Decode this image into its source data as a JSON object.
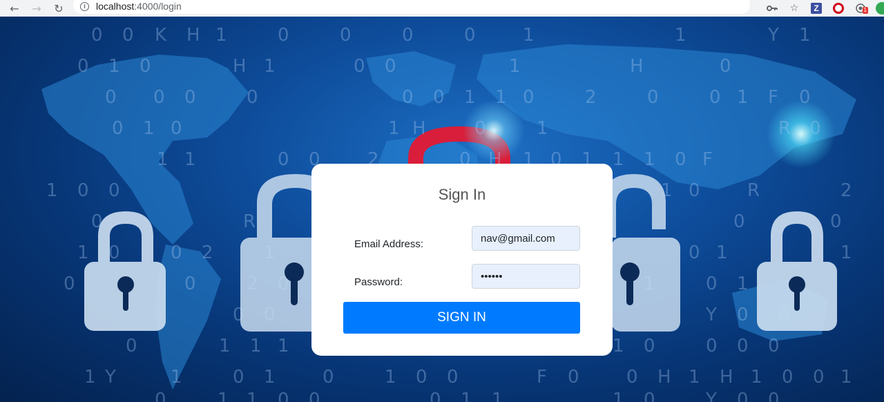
{
  "browser": {
    "url_host": "localhost",
    "url_path": ":4000/login",
    "extension_badge": "1"
  },
  "login": {
    "title": "Sign In",
    "email_label": "Email Address:",
    "email_value": "nav@gmail.com",
    "password_label": "Password:",
    "password_value": "••••••",
    "submit_label": "SIGN IN"
  },
  "background": {
    "digits": [
      [
        "0",
        140,
        52
      ],
      [
        "0",
        185,
        52
      ],
      [
        "K",
        232,
        52
      ],
      [
        "H",
        278,
        52
      ],
      [
        "1",
        320,
        52
      ],
      [
        "0",
        410,
        52
      ],
      [
        "0",
        500,
        52
      ],
      [
        "0",
        590,
        52
      ],
      [
        "0",
        680,
        52
      ],
      [
        "1",
        765,
        52
      ],
      [
        "1",
        985,
        52
      ],
      [
        "Y",
        1120,
        52
      ],
      [
        "1",
        1165,
        52
      ],
      [
        "0",
        120,
        97
      ],
      [
        "1",
        165,
        97
      ],
      [
        "0",
        210,
        97
      ],
      [
        "H",
        345,
        97
      ],
      [
        "1",
        390,
        97
      ],
      [
        "0",
        520,
        97
      ],
      [
        "0",
        565,
        97
      ],
      [
        "1",
        745,
        97
      ],
      [
        "H",
        920,
        97
      ],
      [
        "0",
        1050,
        97
      ],
      [
        "0",
        160,
        142
      ],
      [
        "0",
        230,
        142
      ],
      [
        "0",
        275,
        142
      ],
      [
        "0",
        365,
        142
      ],
      [
        "0",
        590,
        142
      ],
      [
        "0",
        635,
        142
      ],
      [
        "1",
        680,
        142
      ],
      [
        "1",
        725,
        142
      ],
      [
        "0",
        765,
        142
      ],
      [
        "2",
        855,
        142
      ],
      [
        "0",
        945,
        142
      ],
      [
        "0",
        1035,
        142
      ],
      [
        "1",
        1075,
        142
      ],
      [
        "F",
        1120,
        142
      ],
      [
        "0",
        1165,
        142
      ],
      [
        "0",
        170,
        187
      ],
      [
        "1",
        215,
        187
      ],
      [
        "0",
        255,
        187
      ],
      [
        "1",
        570,
        187
      ],
      [
        "H",
        605,
        187
      ],
      [
        "0",
        695,
        187
      ],
      [
        "1",
        785,
        187
      ],
      [
        "R",
        1135,
        187
      ],
      [
        "0",
        1180,
        187
      ],
      [
        "1",
        235,
        232
      ],
      [
        "1",
        275,
        232
      ],
      [
        "0",
        410,
        232
      ],
      [
        "0",
        455,
        232
      ],
      [
        "2",
        540,
        232
      ],
      [
        "0",
        673,
        232
      ],
      [
        "H",
        715,
        232
      ],
      [
        "1",
        765,
        232
      ],
      [
        "0",
        805,
        232
      ],
      [
        "1",
        850,
        232
      ],
      [
        "1",
        895,
        232
      ],
      [
        "1",
        940,
        232
      ],
      [
        "0",
        985,
        232
      ],
      [
        "F",
        1025,
        232
      ],
      [
        "1",
        75,
        277
      ],
      [
        "0",
        120,
        277
      ],
      [
        "0",
        165,
        277
      ],
      [
        "1",
        965,
        277
      ],
      [
        "0",
        1005,
        277
      ],
      [
        "R",
        1090,
        277
      ],
      [
        "2",
        1225,
        277
      ],
      [
        "0",
        140,
        322
      ],
      [
        "R",
        360,
        322
      ],
      [
        "0",
        1070,
        322
      ],
      [
        "0",
        1210,
        322
      ],
      [
        "1",
        120,
        367
      ],
      [
        "0",
        165,
        367
      ],
      [
        "0",
        255,
        367
      ],
      [
        "2",
        300,
        367
      ],
      [
        "1",
        390,
        367
      ],
      [
        "0",
        1005,
        367
      ],
      [
        "1",
        1045,
        367
      ],
      [
        "1",
        1225,
        367
      ],
      [
        "0",
        100,
        412
      ],
      [
        "0",
        275,
        412
      ],
      [
        "2",
        365,
        412
      ],
      [
        "0",
        410,
        412
      ],
      [
        "1",
        940,
        412
      ],
      [
        "0",
        1030,
        412
      ],
      [
        "1",
        1075,
        412
      ],
      [
        "0",
        345,
        457
      ],
      [
        "0",
        390,
        457
      ],
      [
        "Y",
        1030,
        457
      ],
      [
        "0",
        1075,
        457
      ],
      [
        "0",
        1135,
        457
      ],
      [
        "0",
        190,
        502
      ],
      [
        "1",
        325,
        502
      ],
      [
        "1",
        370,
        502
      ],
      [
        "1",
        410,
        502
      ],
      [
        "1",
        895,
        502
      ],
      [
        "0",
        940,
        502
      ],
      [
        "0",
        1030,
        502
      ],
      [
        "0",
        1075,
        502
      ],
      [
        "0",
        1120,
        502
      ],
      [
        "1",
        130,
        547
      ],
      [
        "Y",
        160,
        547
      ],
      [
        "1",
        255,
        547
      ],
      [
        "0",
        345,
        547
      ],
      [
        "1",
        390,
        547
      ],
      [
        "0",
        475,
        547
      ],
      [
        "1",
        565,
        547
      ],
      [
        "0",
        610,
        547
      ],
      [
        "0",
        655,
        547
      ],
      [
        "F",
        785,
        547
      ],
      [
        "0",
        830,
        547
      ],
      [
        "0",
        915,
        547
      ],
      [
        "H",
        960,
        547
      ],
      [
        "1",
        1005,
        547
      ],
      [
        "H",
        1050,
        547
      ],
      [
        "1",
        1095,
        547
      ],
      [
        "0",
        1140,
        547
      ],
      [
        "0",
        1185,
        547
      ],
      [
        "1",
        1225,
        547
      ],
      [
        "0",
        232,
        580
      ],
      [
        "1",
        323,
        580
      ],
      [
        "1",
        365,
        580
      ],
      [
        "0",
        410,
        580
      ],
      [
        "0",
        455,
        580
      ],
      [
        "0",
        630,
        580
      ],
      [
        "1",
        675,
        580
      ],
      [
        "1",
        720,
        580
      ],
      [
        "1",
        895,
        580
      ],
      [
        "0",
        940,
        580
      ],
      [
        "Y",
        1030,
        580
      ],
      [
        "0",
        1075,
        580
      ],
      [
        "0",
        1120,
        580
      ]
    ]
  }
}
